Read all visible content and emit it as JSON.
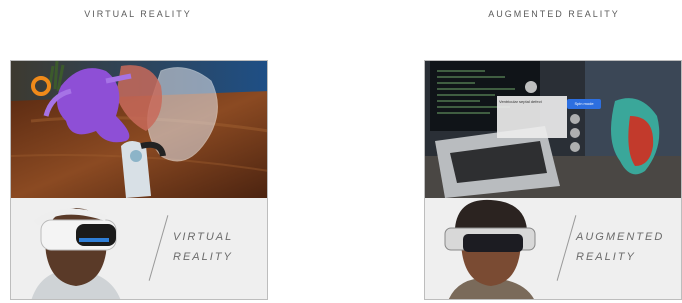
{
  "columns": [
    {
      "title": "VIRTUAL REALITY",
      "card_label_line1": "VIRTUAL",
      "card_label_line2": "REALITY"
    },
    {
      "title": "AUGMENTED REALITY",
      "card_label_line1": "AUGMENTED",
      "card_label_line2": "REALITY",
      "panel": {
        "heading": "Ventricular septal defect",
        "button": "Spin mode"
      }
    }
  ],
  "colors": {
    "table_wood": "#7a3f1e",
    "heart_purple": "#8e4fd6",
    "ar_heart_teal": "#3aa79a",
    "ar_heart_red": "#c23a2c",
    "ar_button_blue": "#2d6fe0"
  }
}
